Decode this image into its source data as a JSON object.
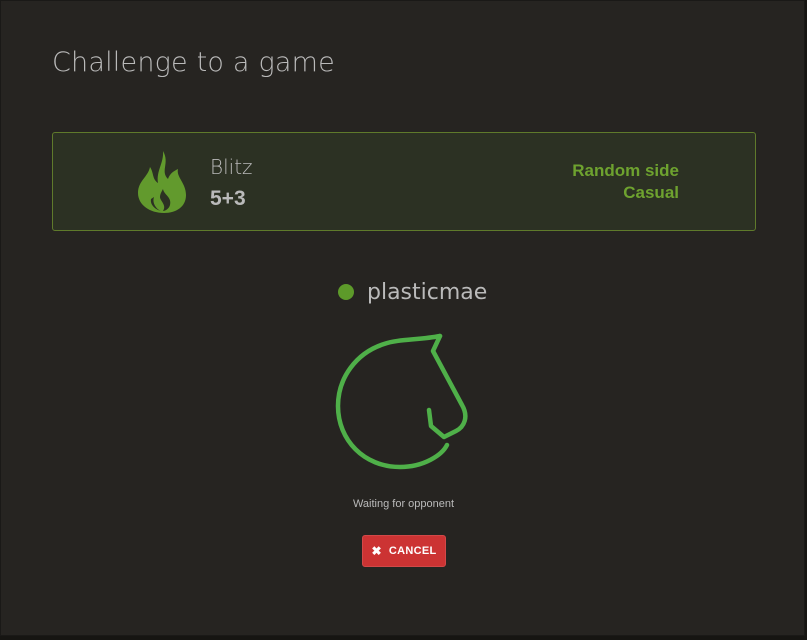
{
  "dialog": {
    "title": "Challenge to a game"
  },
  "game": {
    "speed": "Blitz",
    "speed_icon": "fire-icon",
    "clock": "5+3",
    "color": "Random side",
    "rated": "Casual"
  },
  "opponent": {
    "status": "online",
    "username": "plasticmae"
  },
  "waiting": {
    "icon": "knight-logo-icon",
    "text": "Waiting for opponent"
  },
  "cancel": {
    "icon": "close-icon",
    "label": "CANCEL"
  },
  "colors": {
    "background": "#262421",
    "accent_green": "#6ea22f",
    "logo_green": "#4fb049",
    "cancel_red": "#cc3333"
  }
}
